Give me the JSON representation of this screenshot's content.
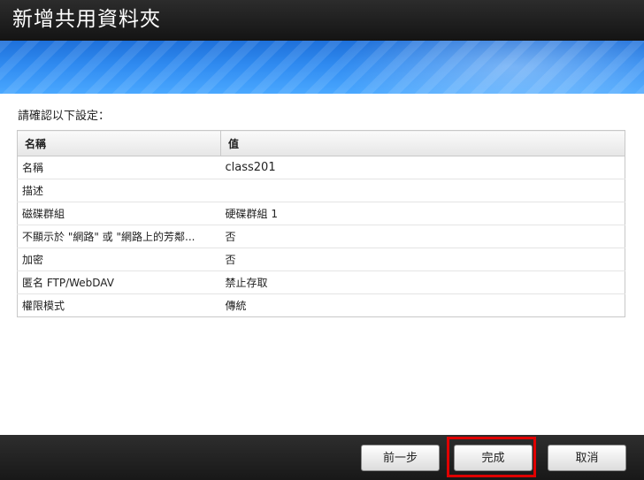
{
  "dialog": {
    "title": "新增共用資料夾",
    "prompt": "請確認以下設定："
  },
  "table": {
    "headers": {
      "name": "名稱",
      "value": "值"
    },
    "rows": [
      {
        "name": "名稱",
        "value": "class201"
      },
      {
        "name": "描述",
        "value": ""
      },
      {
        "name": "磁碟群組",
        "value": "硬碟群組 1"
      },
      {
        "name": "不顯示於 \"網路\" 或 \"網路上的芳鄰...",
        "value": "否"
      },
      {
        "name": "加密",
        "value": "否"
      },
      {
        "name": "匿名 FTP/WebDAV",
        "value": "禁止存取"
      },
      {
        "name": "權限模式",
        "value": "傳統"
      }
    ]
  },
  "footer": {
    "prev_label": "前一步",
    "finish_label": "完成",
    "cancel_label": "取消"
  },
  "colors": {
    "titlebar": "#1f1f1f",
    "banner": "#2f8af0",
    "highlight": "#e00000"
  }
}
